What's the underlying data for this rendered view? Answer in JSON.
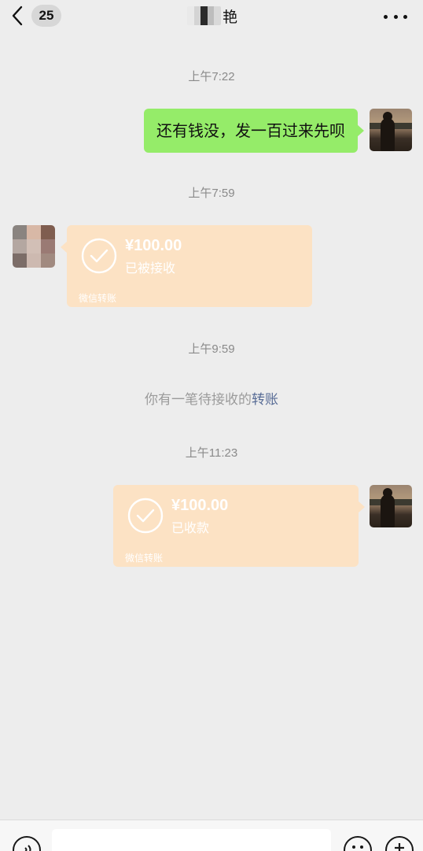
{
  "navbar": {
    "unread_count": "25",
    "title_visible_char": "艳",
    "more_icon": "more-dots-icon",
    "back_icon": "chevron-left-icon"
  },
  "messages": [
    {
      "type": "time",
      "text": "上午7:22"
    },
    {
      "type": "text",
      "side": "right",
      "text": "还有钱没，发一百过来先呗"
    },
    {
      "type": "time",
      "text": "上午7:59"
    },
    {
      "type": "transfer",
      "side": "left",
      "amount": "¥100.00",
      "status": "已被接收",
      "source": "微信转账"
    },
    {
      "type": "time",
      "text": "上午9:59"
    },
    {
      "type": "system",
      "text": "你有一笔待接收的",
      "link": "转账"
    },
    {
      "type": "time",
      "text": "上午11:23"
    },
    {
      "type": "transfer",
      "side": "right",
      "amount": "¥100.00",
      "status": "已收款",
      "source": "微信转账"
    }
  ],
  "input_bar": {
    "voice_icon": "voice-icon",
    "emoji_icon": "emoji-icon",
    "plus_icon": "plus-icon",
    "input_value": ""
  },
  "colors": {
    "background": "#ededed",
    "text_bubble": "#95ec69",
    "transfer_card": "#fce2c4",
    "link": "#576b95"
  }
}
